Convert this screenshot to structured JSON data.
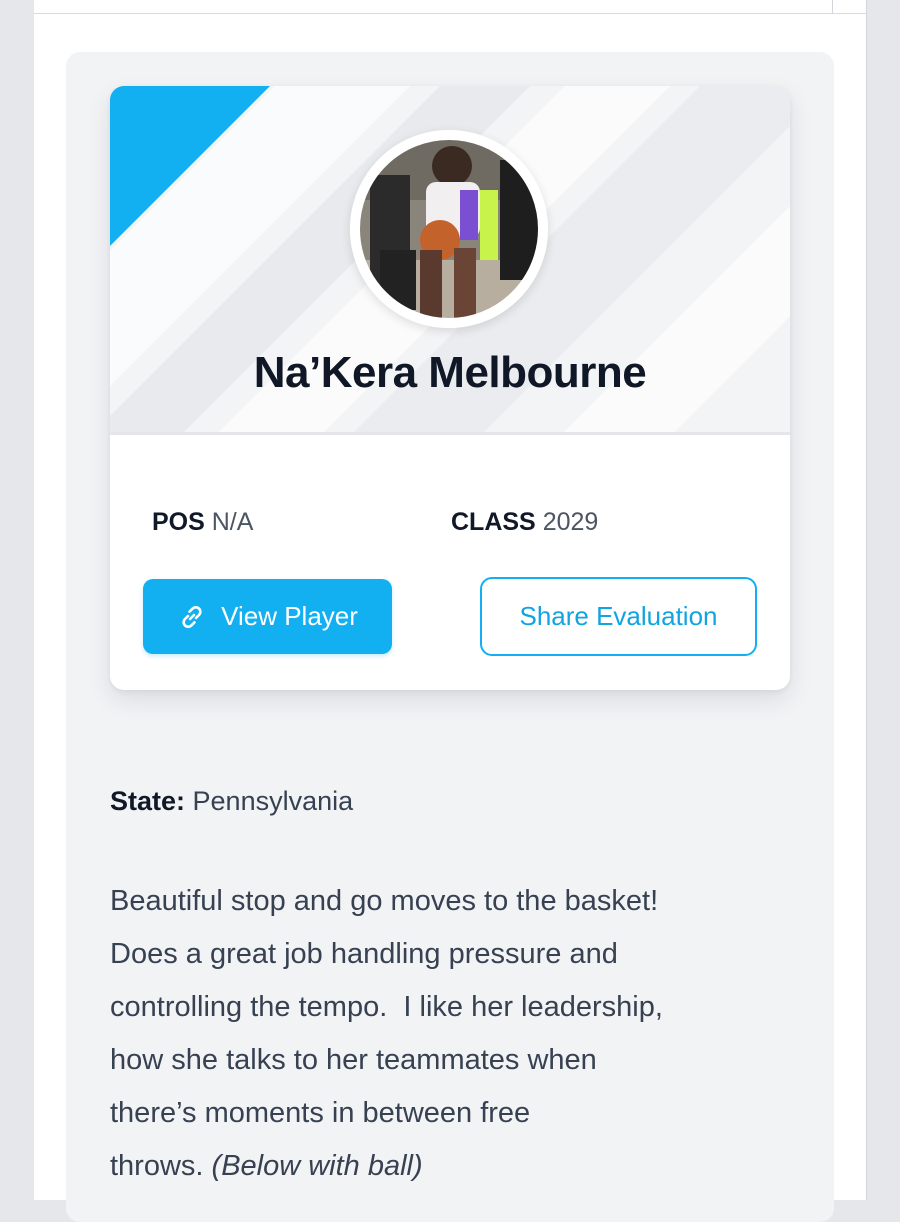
{
  "player": {
    "name": "Na’Kera Melbourne",
    "pos_label": "POS",
    "pos_value": "N/A",
    "class_label": "CLASS",
    "class_value": "2029"
  },
  "actions": {
    "view_player": "View Player",
    "share_evaluation": "Share Evaluation"
  },
  "details": {
    "state_label": "State:",
    "state_value": "Pennsylvania"
  },
  "evaluation": {
    "lines": [
      "Beautiful stop and go moves to the basket!",
      "Does a great job handling pressure and",
      "controlling the tempo.  I like her leadership,",
      "how she talks to her teammates when",
      "there’s moments in between free",
      "throws. "
    ],
    "note": "(Below with ball)"
  },
  "colors": {
    "accent": "#12b0f0",
    "name_text": "#101828",
    "body_text": "#374151",
    "card_background": "#f2f3f5"
  },
  "icons": {
    "view_player": "link-icon"
  }
}
